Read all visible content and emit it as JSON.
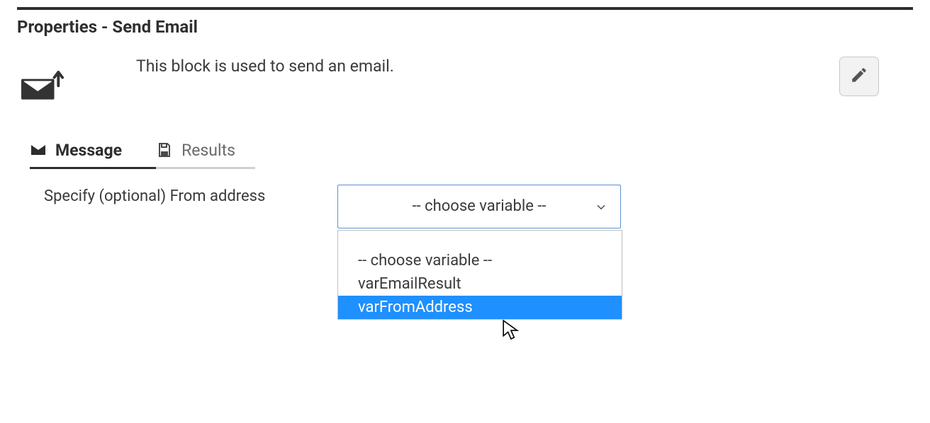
{
  "panel": {
    "title": "Properties - Send Email",
    "description": "This block is used to send an email."
  },
  "tabs": {
    "message": "Message",
    "results": "Results"
  },
  "form": {
    "from_label": "Specify (optional) From address"
  },
  "select": {
    "selected": "-- choose variable --",
    "options": {
      "o0": "-- choose variable --",
      "o1": "varEmailResult",
      "o2": "varFromAddress"
    }
  }
}
